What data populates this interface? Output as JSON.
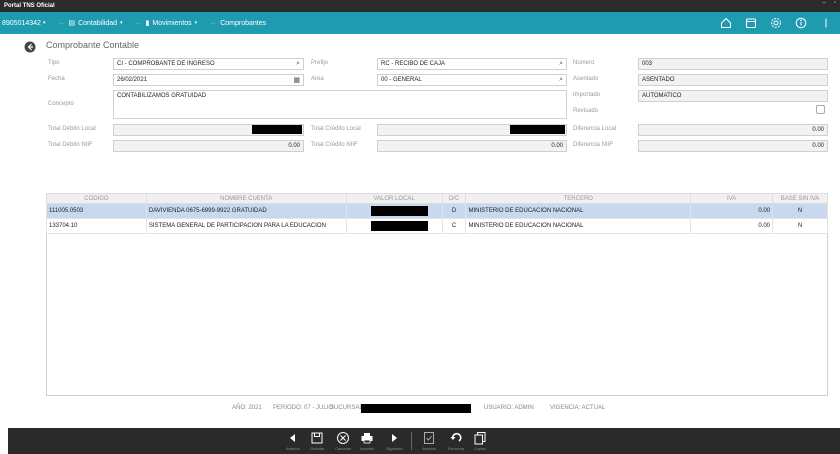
{
  "window": {
    "title": "Portal TNS Oficial",
    "controls": [
      "–",
      "▫"
    ]
  },
  "nav": {
    "account": "8905014342",
    "items": [
      {
        "label": "Contabilidad",
        "icon": "ledger-icon",
        "has_dropdown": true
      },
      {
        "label": "Movimientos",
        "icon": "book-icon",
        "has_dropdown": true
      },
      {
        "label": "Comprobantes",
        "icon": "",
        "has_dropdown": false
      }
    ]
  },
  "page": {
    "title": "Comprobante Contable"
  },
  "form": {
    "tipo": {
      "label": "Tipo",
      "value": "CI - COMPROBANTE DE INGRESO"
    },
    "prefijo": {
      "label": "Prefijo",
      "value": "RC - RECIBO DE CAJA"
    },
    "numero": {
      "label": "Número",
      "value": "003"
    },
    "fecha": {
      "label": "Fecha",
      "value": "26/02/2021"
    },
    "area": {
      "label": "Area",
      "value": "00 - GENERAL"
    },
    "asentado": {
      "label": "Asentado",
      "value": "ASENTADO"
    },
    "concepto": {
      "label": "Concepto",
      "value": "CONTABILIZAMOS GRATUIDAD"
    },
    "importado": {
      "label": "Importado",
      "value": "AUTOMATICO"
    },
    "revisado": {
      "label": "Revisado",
      "checked": false
    },
    "total_debito_local": {
      "label": "Total Débito Local",
      "value": ""
    },
    "total_credito_local": {
      "label": "Total Crédito Local",
      "value": ""
    },
    "diferencia_local": {
      "label": "Diferencia Local",
      "value": "0.00"
    },
    "total_debito_niif": {
      "label": "Total Débito NIIF",
      "value": "0.00"
    },
    "total_credito_niif": {
      "label": "Total Crédito NIIF",
      "value": "0.00"
    },
    "diferencia_niif": {
      "label": "Diferencia NIIF",
      "value": "0.00"
    }
  },
  "grid": {
    "columns": [
      "CODIGO",
      "NOMBRE CUENTA",
      "VALOR LOCAL",
      "D/C",
      "TERCERO",
      "IVA",
      "BASE SIN IVA"
    ],
    "rows": [
      {
        "codigo": "111005.0503",
        "nombre": "DAVIVIENDA 0675-6999-9922 GRATUIDAD",
        "valor": "",
        "dc": "D",
        "tercero": "MINISTERIO DE EDUCACION NACIONAL",
        "iva": "0.00",
        "base": "N",
        "selected": true
      },
      {
        "codigo": "133704.10",
        "nombre": "SISTEMA GENERAL DE PARTICIPACION PARA LA EDUCACION",
        "valor": "",
        "dc": "C",
        "tercero": "MINISTERIO DE EDUCACION NACIONAL",
        "iva": "0.00",
        "base": "N",
        "selected": false
      }
    ]
  },
  "status": {
    "anio": "AÑO: 2021",
    "periodo": "PERIODO: 07 - JULIO",
    "sucursal": "SUCURSAL:",
    "usuario": "USUARIO: ADMIN",
    "vigencia": "VIGENCIA: ACTUAL"
  },
  "toolbar": {
    "anterior": "Anterior",
    "guardar": "Guardar",
    "cancelar": "Cancelar",
    "imprimir": "Imprimir",
    "siguiente": "Siguiente",
    "asentar": "Asentar",
    "reversar": "Reversar",
    "copiar": "Copiar"
  },
  "colors": {
    "nav_bg": "#1f9bb0",
    "selected_row": "#c7d9ef",
    "bottom_bar": "#2a2a2a"
  }
}
